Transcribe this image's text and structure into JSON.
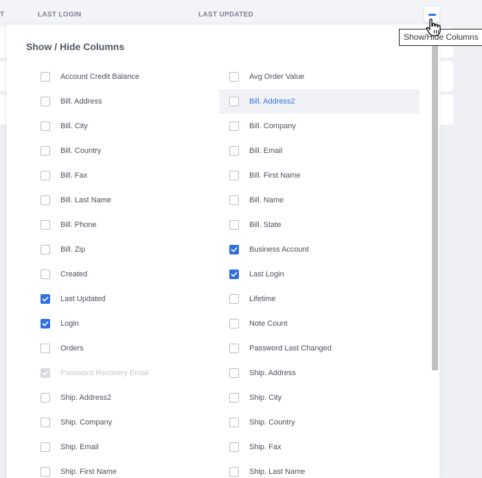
{
  "table_header": {
    "partial_col": "T",
    "col_last_login": "LAST LOGIN",
    "col_last_updated": "LAST UPDATED"
  },
  "tooltip": "Show/Hide Columns",
  "panel": {
    "title": "Show / Hide Columns",
    "left_options": [
      {
        "label": "Account Credit Balance",
        "checked": false
      },
      {
        "label": "Bill. Address",
        "checked": false
      },
      {
        "label": "Bill. City",
        "checked": false
      },
      {
        "label": "Bill. Country",
        "checked": false
      },
      {
        "label": "Bill. Fax",
        "checked": false
      },
      {
        "label": "Bill. Last Name",
        "checked": false
      },
      {
        "label": "Bill. Phone",
        "checked": false
      },
      {
        "label": "Bill. Zip",
        "checked": false
      },
      {
        "label": "Created",
        "checked": false
      },
      {
        "label": "Last Updated",
        "checked": true
      },
      {
        "label": "Login",
        "checked": true
      },
      {
        "label": "Orders",
        "checked": false
      },
      {
        "label": "Password Recovery Email",
        "checked": true,
        "disabled": true
      },
      {
        "label": "Ship. Address2",
        "checked": false
      },
      {
        "label": "Ship. Company",
        "checked": false
      },
      {
        "label": "Ship. Email",
        "checked": false
      },
      {
        "label": "Ship. First Name",
        "checked": false
      }
    ],
    "right_options": [
      {
        "label": "Avg Order Value",
        "checked": false
      },
      {
        "label": "Bill. Address2",
        "checked": false,
        "highlighted": true
      },
      {
        "label": "Bill. Company",
        "checked": false
      },
      {
        "label": "Bill. Email",
        "checked": false
      },
      {
        "label": "Bill. First Name",
        "checked": false
      },
      {
        "label": "Bill. Name",
        "checked": false
      },
      {
        "label": "Bill. State",
        "checked": false
      },
      {
        "label": "Business Account",
        "checked": true
      },
      {
        "label": "Last Login",
        "checked": true
      },
      {
        "label": "Lifetime",
        "checked": false
      },
      {
        "label": "Note Count",
        "checked": false
      },
      {
        "label": "Password Last Changed",
        "checked": false
      },
      {
        "label": "Ship. Address",
        "checked": false
      },
      {
        "label": "Ship. City",
        "checked": false
      },
      {
        "label": "Ship. Country",
        "checked": false
      },
      {
        "label": "Ship. Fax",
        "checked": false
      },
      {
        "label": "Ship. Last Name",
        "checked": false
      }
    ]
  },
  "colors": {
    "accent": "#2f6fde",
    "checkbox_disabled": "#d7d9df",
    "highlight_row": "#f1f2f6"
  },
  "icons": {
    "toggle": "minus-icon",
    "cursor": "hand-pointer-icon",
    "check": "checkmark-icon"
  }
}
